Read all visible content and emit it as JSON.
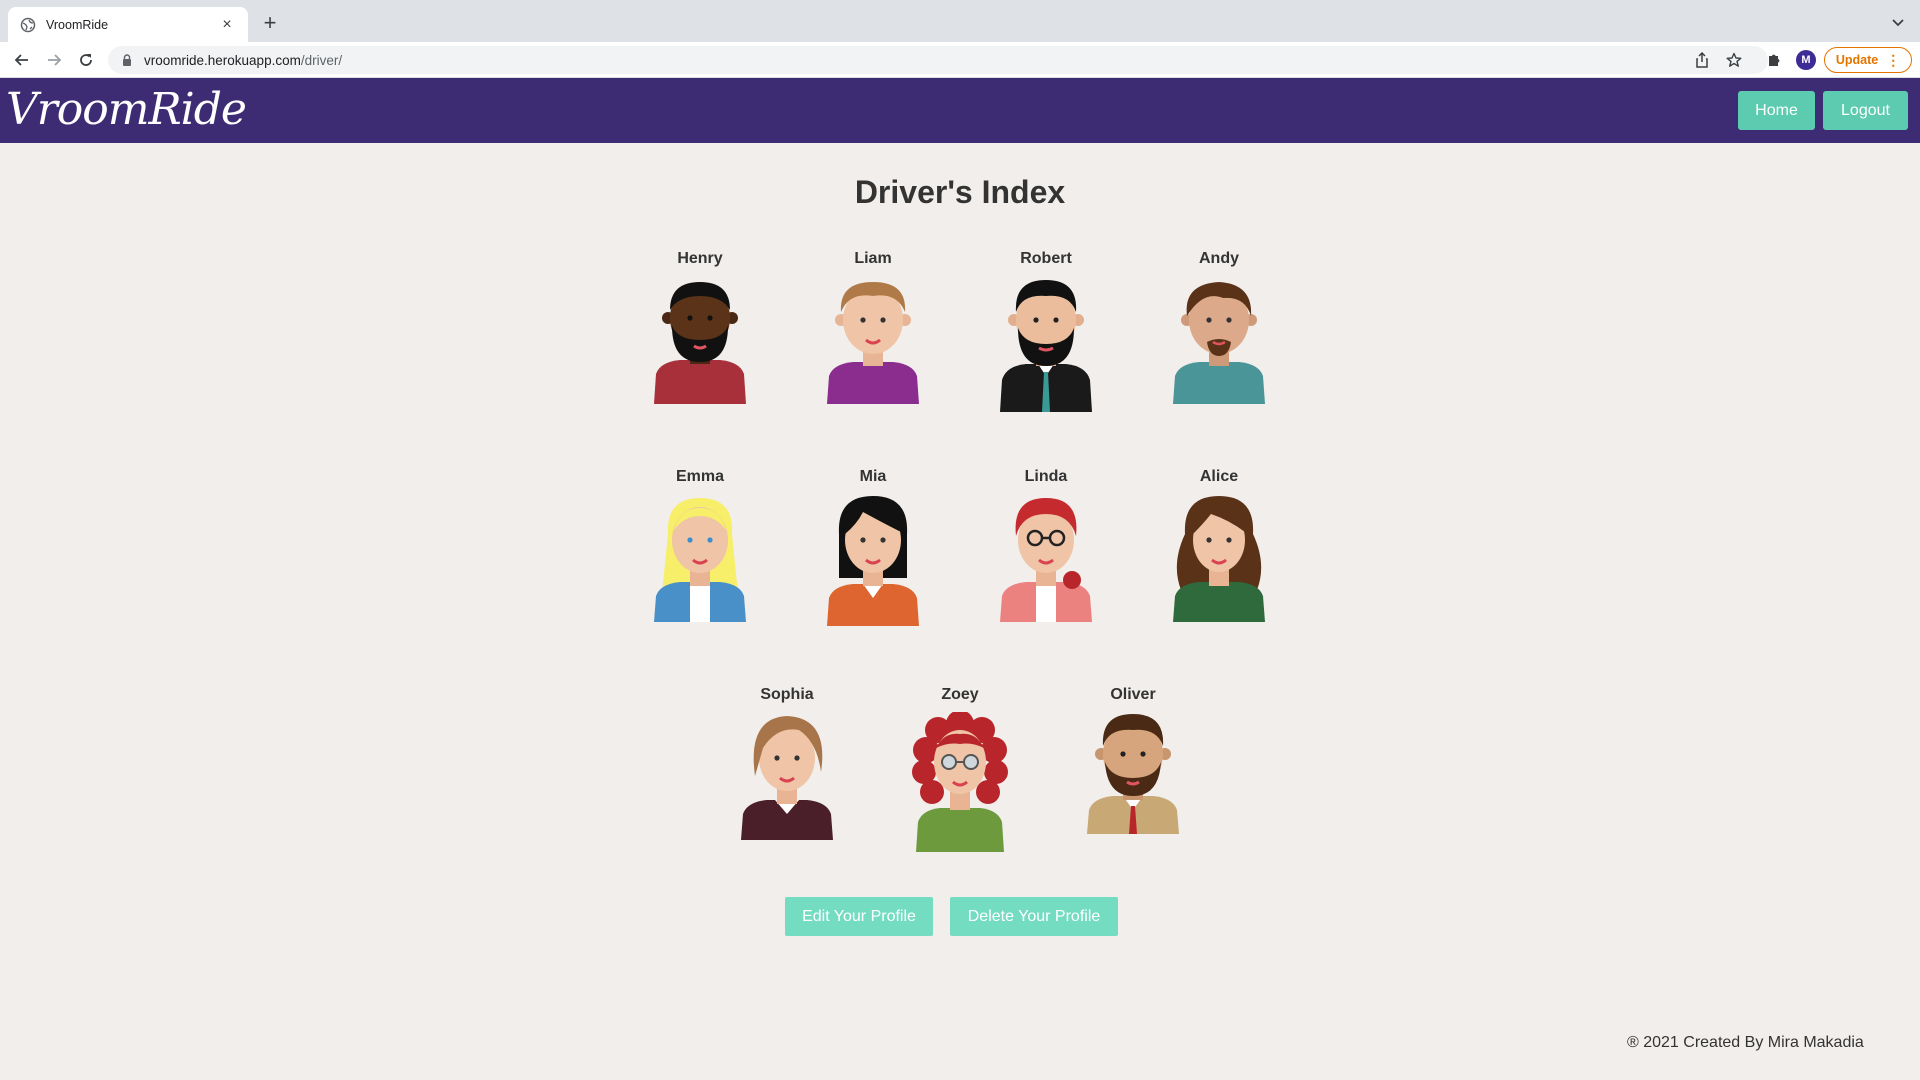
{
  "browser": {
    "tab_title": "VroomRide",
    "tab_close": "×",
    "new_tab": "+",
    "url_host": "vroomride.herokuapp.com",
    "url_path": "/driver/",
    "profile_initial": "M",
    "update_label": "Update",
    "update_menu": "⋮"
  },
  "navbar": {
    "logo": "VroomRide",
    "home_label": "Home",
    "logout_label": "Logout",
    "color": "#3d2b73",
    "button_color": "#5ccbb0"
  },
  "main": {
    "title": "Driver's Index",
    "drivers": [
      {
        "name": "Henry"
      },
      {
        "name": "Liam"
      },
      {
        "name": "Robert"
      },
      {
        "name": "Andy"
      },
      {
        "name": "Emma"
      },
      {
        "name": "Mia"
      },
      {
        "name": "Linda"
      },
      {
        "name": "Alice"
      },
      {
        "name": "Sophia"
      },
      {
        "name": "Zoey"
      },
      {
        "name": "Oliver"
      }
    ],
    "edit_label": "Edit Your Profile",
    "delete_label": "Delete Your Profile"
  },
  "footer": {
    "text": "® 2021 Created By Mira Makadia"
  }
}
